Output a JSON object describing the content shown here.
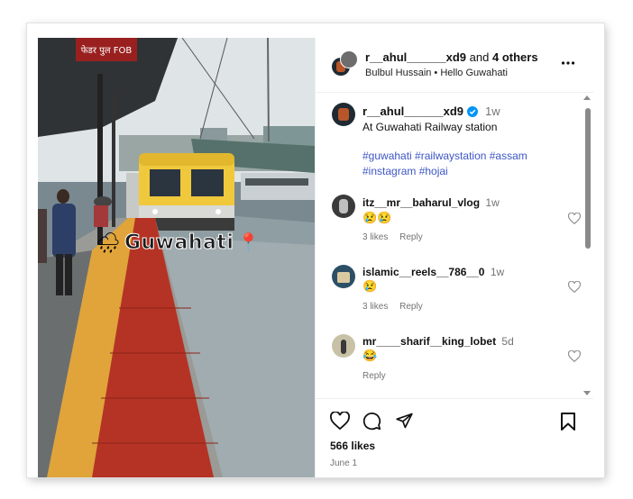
{
  "media": {
    "overlay_text": "Guwahati",
    "station_sign": "फेडर पुल FOB",
    "train_number": "1"
  },
  "header": {
    "username": "r__ahul______xd9",
    "and_text": "and",
    "others": "4 others",
    "subtitle": "Bulbul Hussain • Hello Guwahati",
    "more_label": "..."
  },
  "caption": {
    "username": "r__ahul______xd9",
    "time": "1w",
    "text": "At Guwahati Railway station",
    "hashtags_line1": "#guwahati #railwaystation #assam",
    "hashtags_line2": "#instagram #hojai"
  },
  "comments": [
    {
      "username": "itz__mr__baharul_vlog",
      "time": "1w",
      "emoji": "😢😢",
      "likes": "3 likes",
      "reply": "Reply"
    },
    {
      "username": "islamic__reels__786__0",
      "time": "1w",
      "emoji": "😢",
      "likes": "3 likes",
      "reply": "Reply"
    },
    {
      "username": "mr____sharif__king_lobet",
      "time": "5d",
      "emoji": "😂",
      "likes": "",
      "reply": "Reply"
    }
  ],
  "footer": {
    "likes": "566 likes",
    "date": "June 1"
  },
  "colors": {
    "verified": "#0095f6",
    "hashtag": "#3d56c4",
    "train_yellow": "#f0c83c"
  },
  "icons": [
    "more-icon",
    "verified-icon",
    "heart-icon",
    "comment-icon",
    "share-icon",
    "bookmark-icon",
    "scroll-up-icon",
    "scroll-down-icon"
  ]
}
